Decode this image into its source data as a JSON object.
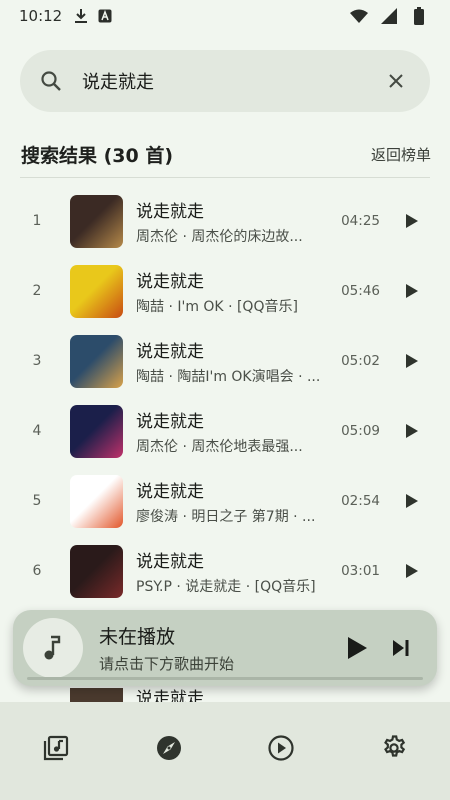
{
  "status_bar": {
    "time": "10:12",
    "icons": [
      "download-icon",
      "a-badge-icon",
      "wifi-icon",
      "signal-icon",
      "battery-icon"
    ]
  },
  "search": {
    "value": "说走就走",
    "icon": "search-icon",
    "clear_icon": "close-icon"
  },
  "results": {
    "title": "搜索结果 (30 首)",
    "back_label": "返回榜单"
  },
  "songs": [
    {
      "index": "1",
      "title": "说走就走",
      "subtitle": "周杰伦 · 周杰伦的床边故...",
      "duration": "04:25",
      "cover_colors": [
        "#3b2a24",
        "#b68a4a"
      ]
    },
    {
      "index": "2",
      "title": "说走就走",
      "subtitle": "陶喆 · I'm OK · [QQ音乐]",
      "duration": "05:46",
      "cover_colors": [
        "#e9c81b",
        "#c84b12"
      ]
    },
    {
      "index": "3",
      "title": "说走就走",
      "subtitle": "陶喆 · 陶喆I'm OK演唱会 · ...",
      "duration": "05:02",
      "cover_colors": [
        "#2c4c6a",
        "#d9a24a"
      ]
    },
    {
      "index": "4",
      "title": "说走就走",
      "subtitle": "周杰伦 · 周杰伦地表最强...",
      "duration": "05:09",
      "cover_colors": [
        "#1b1f4a",
        "#c0316a"
      ]
    },
    {
      "index": "5",
      "title": "说走就走",
      "subtitle": "廖俊涛 · 明日之子 第7期 · ...",
      "duration": "02:54",
      "cover_colors": [
        "#ffffff",
        "#e2562a"
      ]
    },
    {
      "index": "6",
      "title": "说走就走",
      "subtitle": "PSY.P · 说走就走 · [QQ音乐]",
      "duration": "03:01",
      "cover_colors": [
        "#2a1a1a",
        "#7a2a2a"
      ]
    }
  ],
  "peek_song": {
    "title": "说走就走"
  },
  "mini_player": {
    "title": "未在播放",
    "subtitle": "请点击下方歌曲开始",
    "progress": 0
  },
  "bottom_nav": {
    "items": [
      "library-icon",
      "explore-icon",
      "play-circle-icon",
      "settings-icon"
    ]
  }
}
